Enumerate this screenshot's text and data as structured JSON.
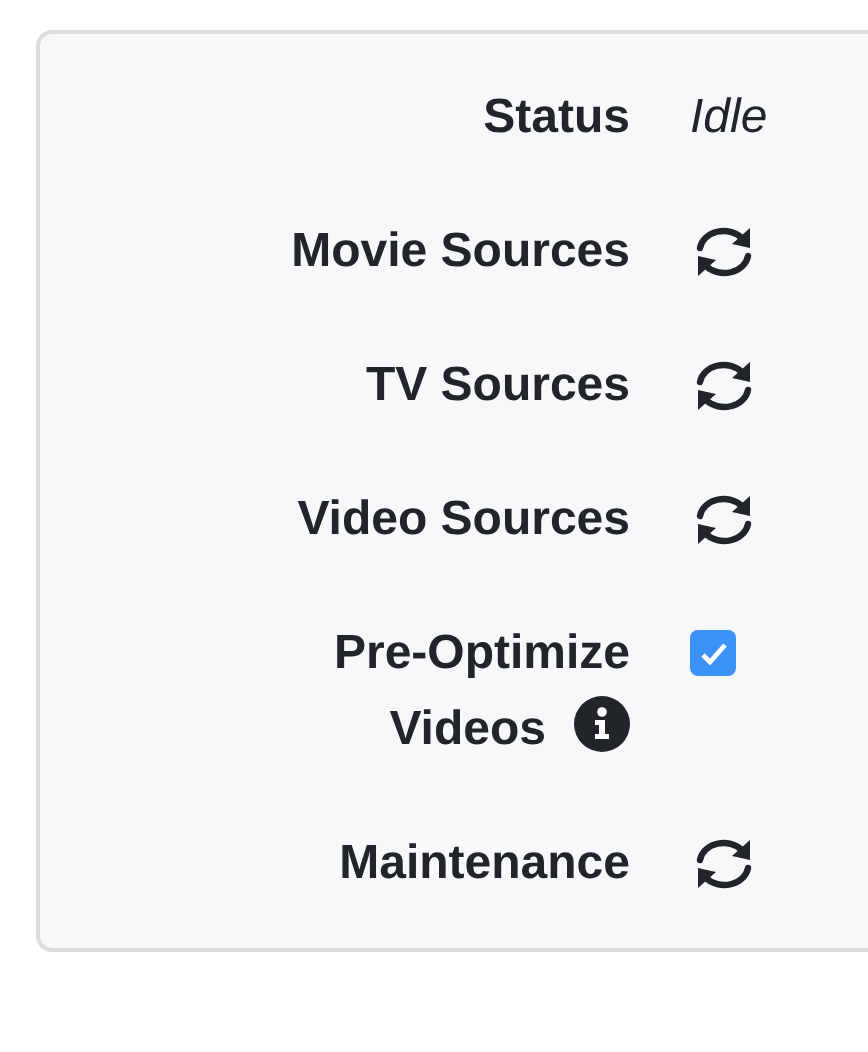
{
  "rows": [
    {
      "label": "Status",
      "kind": "text",
      "value": "Idle"
    },
    {
      "label": "Movie Sources",
      "kind": "refresh"
    },
    {
      "label": "TV Sources",
      "kind": "refresh"
    },
    {
      "label": "Video Sources",
      "kind": "refresh"
    },
    {
      "label": "Pre-Optimize Videos",
      "kind": "checkbox",
      "checked": true,
      "info": true
    },
    {
      "label": "Maintenance",
      "kind": "refresh"
    }
  ]
}
